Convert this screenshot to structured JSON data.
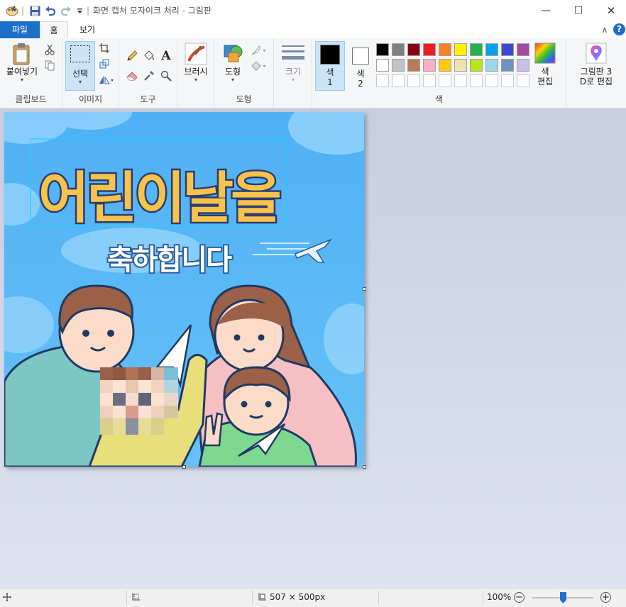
{
  "window": {
    "title": "화면 캡처 모자이크 처리 - 그림판",
    "minimize_symbol": "—",
    "maximize_symbol": "☐",
    "close_symbol": "✕"
  },
  "tabs": [
    {
      "label": "파일"
    },
    {
      "label": "홈"
    },
    {
      "label": "보기"
    }
  ],
  "ribbon": {
    "collapse_symbol": "∧",
    "help_symbol": "?",
    "clipboard": {
      "paste_label": "붙여넣기",
      "group_label": "클립보드"
    },
    "image": {
      "select_label": "선택",
      "group_label": "이미지"
    },
    "tools": {
      "group_label": "도구",
      "text_symbol": "A"
    },
    "brushes": {
      "label": "브러시"
    },
    "shapes": {
      "label": "도형",
      "group_label": "도형"
    },
    "size": {
      "label": "크기"
    },
    "colors": {
      "color1_label": "색",
      "color1_index": "1",
      "color2_label": "색",
      "color2_index": "2",
      "edit_label_1": "색",
      "edit_label_2": "편집",
      "group_label": "색",
      "color1_value": "#000000",
      "color2_value": "#ffffff",
      "palette_row1": [
        "#000000",
        "#7f7f7f",
        "#880015",
        "#ed1c24",
        "#ff7f27",
        "#fff200",
        "#22b14c",
        "#00a2e8",
        "#3f48cc",
        "#a349a4"
      ],
      "palette_row2": [
        "#ffffff",
        "#c3c3c3",
        "#b97a57",
        "#ffaec9",
        "#ffc90e",
        "#efe4b0",
        "#b5e61d",
        "#99d9ea",
        "#7092be",
        "#c8bfe7"
      ]
    },
    "paint3d": {
      "label_1": "그림판 3",
      "label_2": "D로 편집"
    }
  },
  "canvas_art": {
    "headline": "어린이날을",
    "subline": "축하합니다"
  },
  "statusbar": {
    "image_size": "507 × 500px",
    "zoom": "100%",
    "zoom_out_symbol": "−",
    "zoom_in_symbol": "+",
    "zoom_level_fraction": 0.5
  }
}
